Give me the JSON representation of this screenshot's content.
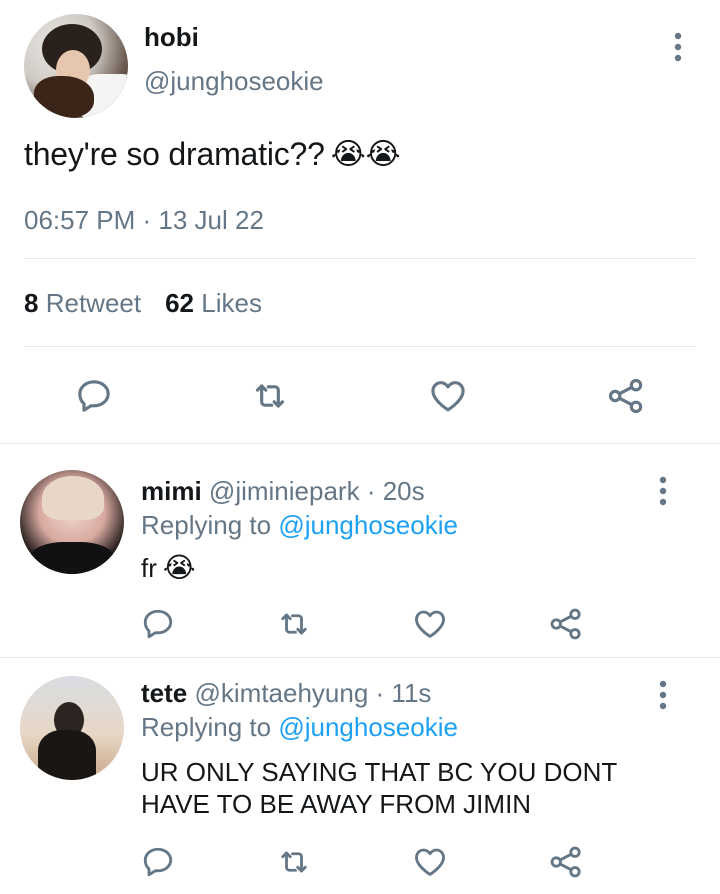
{
  "main_tweet": {
    "name": "hobi",
    "handle": "@junghoseokie",
    "text": "they're so dramatic??",
    "emojis": [
      "😭",
      "😭"
    ],
    "time": "06:57 PM · 13 Jul 22",
    "retweet_count": "8",
    "retweet_label": "Retweet",
    "likes_count": "62",
    "likes_label": "Likes"
  },
  "replies": [
    {
      "name": "mimi",
      "handle": "@jiminiepark",
      "age": "· 20s",
      "replying_label": "Replying to",
      "replying_to": "@junghoseokie",
      "text": "fr",
      "emoji": "😭"
    },
    {
      "name": "tete",
      "handle": "@kimtaehyung",
      "age": "· 11s",
      "replying_label": "Replying to",
      "replying_to": "@junghoseokie",
      "text_line1": "UR ONLY SAYING THAT BC YOU DONT",
      "text_line2": "HAVE TO BE AWAY FROM JIMIN"
    }
  ],
  "icons": {
    "reply": "reply-icon",
    "retweet": "retweet-icon",
    "like": "heart-icon",
    "share": "share-icon",
    "more": "more-vertical-icon"
  },
  "colors": {
    "text": "#14171a",
    "muted": "#657786",
    "link": "#1da1f2",
    "divider": "#e1e8ed"
  }
}
